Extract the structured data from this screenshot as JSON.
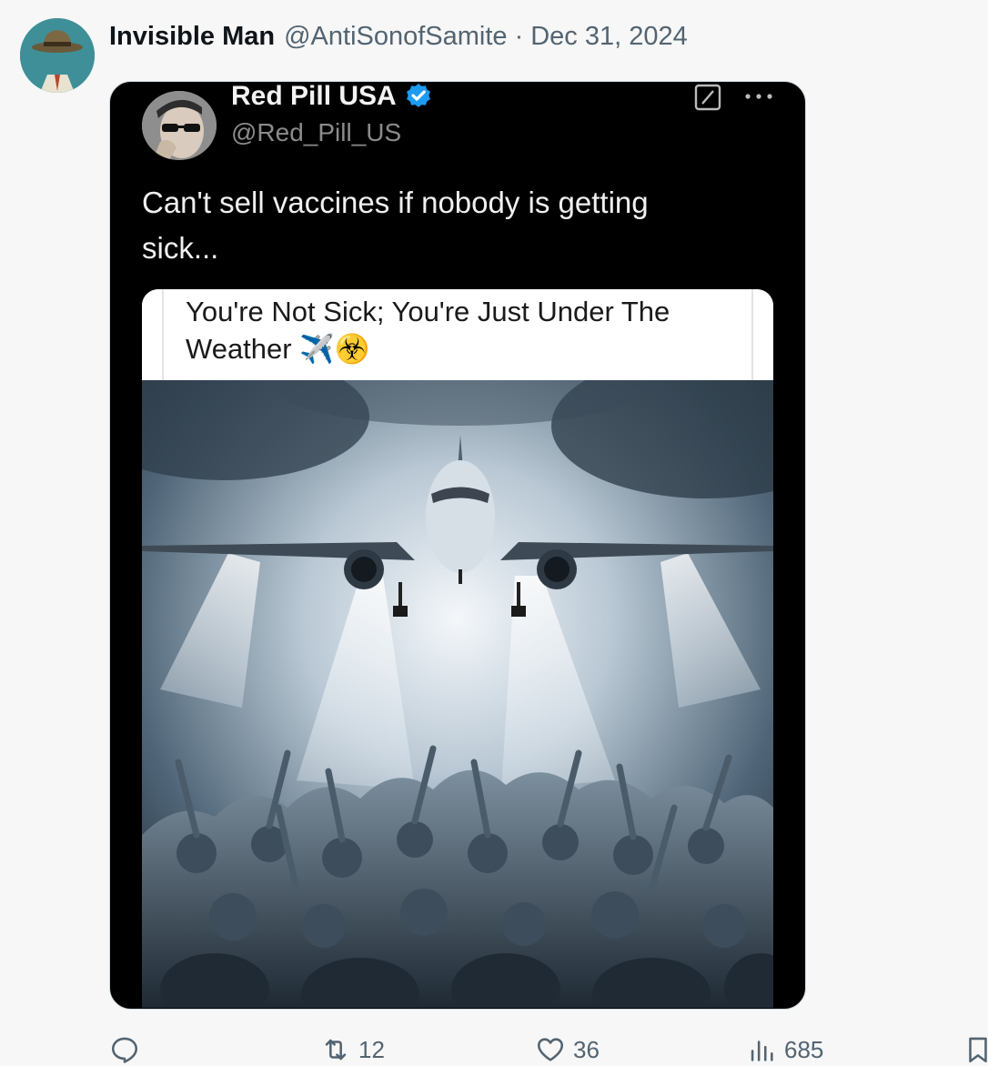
{
  "post": {
    "display_name": "Invisible Man",
    "handle": "@AntiSonofSamite",
    "separator": "·",
    "date": "Dec 31, 2024",
    "avatar_icon": "fedora-hat-avatar-icon"
  },
  "embedded": {
    "display_name": "Red Pill USA",
    "verified_color": "#1d9bf0",
    "handle": "@Red_Pill_US",
    "text": "Can't sell vaccines if nobody is getting sick...",
    "meme_caption": "You're Not Sick; You're Just Under The Weather ✈️☣️",
    "background": "#000000"
  },
  "actions": {
    "reply_count": "",
    "repost_count": "12",
    "like_count": "36",
    "views_count": "685"
  },
  "colors": {
    "page_bg": "#f7f7f7",
    "muted_text": "#536471",
    "primary_text": "#0f1419"
  }
}
